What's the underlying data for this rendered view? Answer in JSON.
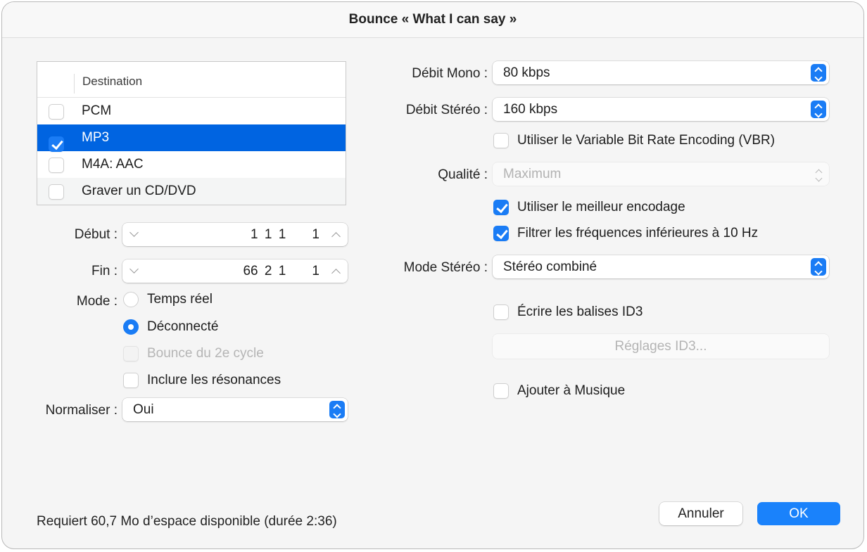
{
  "window": {
    "title": "Bounce « What I can say »"
  },
  "destination": {
    "header": "Destination",
    "items": [
      {
        "label": "PCM",
        "checked": false,
        "selected": false
      },
      {
        "label": "MP3",
        "checked": true,
        "selected": true
      },
      {
        "label": "M4A: AAC",
        "checked": false,
        "selected": false
      },
      {
        "label": "Graver un CD/DVD",
        "checked": false,
        "selected": false
      }
    ]
  },
  "left": {
    "start_label": "Début :",
    "start_value": "1 1 1    1",
    "end_label": "Fin :",
    "end_value": "66 2 1    1",
    "mode_label": "Mode :",
    "mode_options": [
      {
        "label": "Temps réel",
        "selected": false
      },
      {
        "label": "Déconnecté",
        "selected": true
      }
    ],
    "second_cycle": {
      "label": "Bounce du 2e cycle",
      "checked": false,
      "disabled": true
    },
    "include_tails": {
      "label": "Inclure les résonances",
      "checked": false
    },
    "normalize_label": "Normaliser :",
    "normalize_value": "Oui"
  },
  "right": {
    "mono_rate_label": "Débit Mono :",
    "mono_rate_value": "80 kbps",
    "stereo_rate_label": "Débit Stéréo :",
    "stereo_rate_value": "160 kbps",
    "vbr": {
      "label": "Utiliser le Variable Bit Rate Encoding (VBR)",
      "checked": false
    },
    "quality_label": "Qualité :",
    "quality_value": "Maximum",
    "best_encoding": {
      "label": "Utiliser le meilleur encodage",
      "checked": true
    },
    "filter_low": {
      "label": "Filtrer les fréquences inférieures à 10 Hz",
      "checked": true
    },
    "stereo_mode_label": "Mode Stéréo :",
    "stereo_mode_value": "Stéréo combiné",
    "write_id3": {
      "label": "Écrire les balises ID3",
      "checked": false
    },
    "id3_settings_button": "Réglages ID3...",
    "add_to_music": {
      "label": "Ajouter à Musique",
      "checked": false
    }
  },
  "footer": {
    "status": "Requiert 60,7 Mo d’espace disponible (durée 2:36)",
    "cancel_label": "Annuler",
    "ok_label": "OK"
  },
  "colors": {
    "accent": "#1a7cf5",
    "selection": "#0064e1"
  }
}
